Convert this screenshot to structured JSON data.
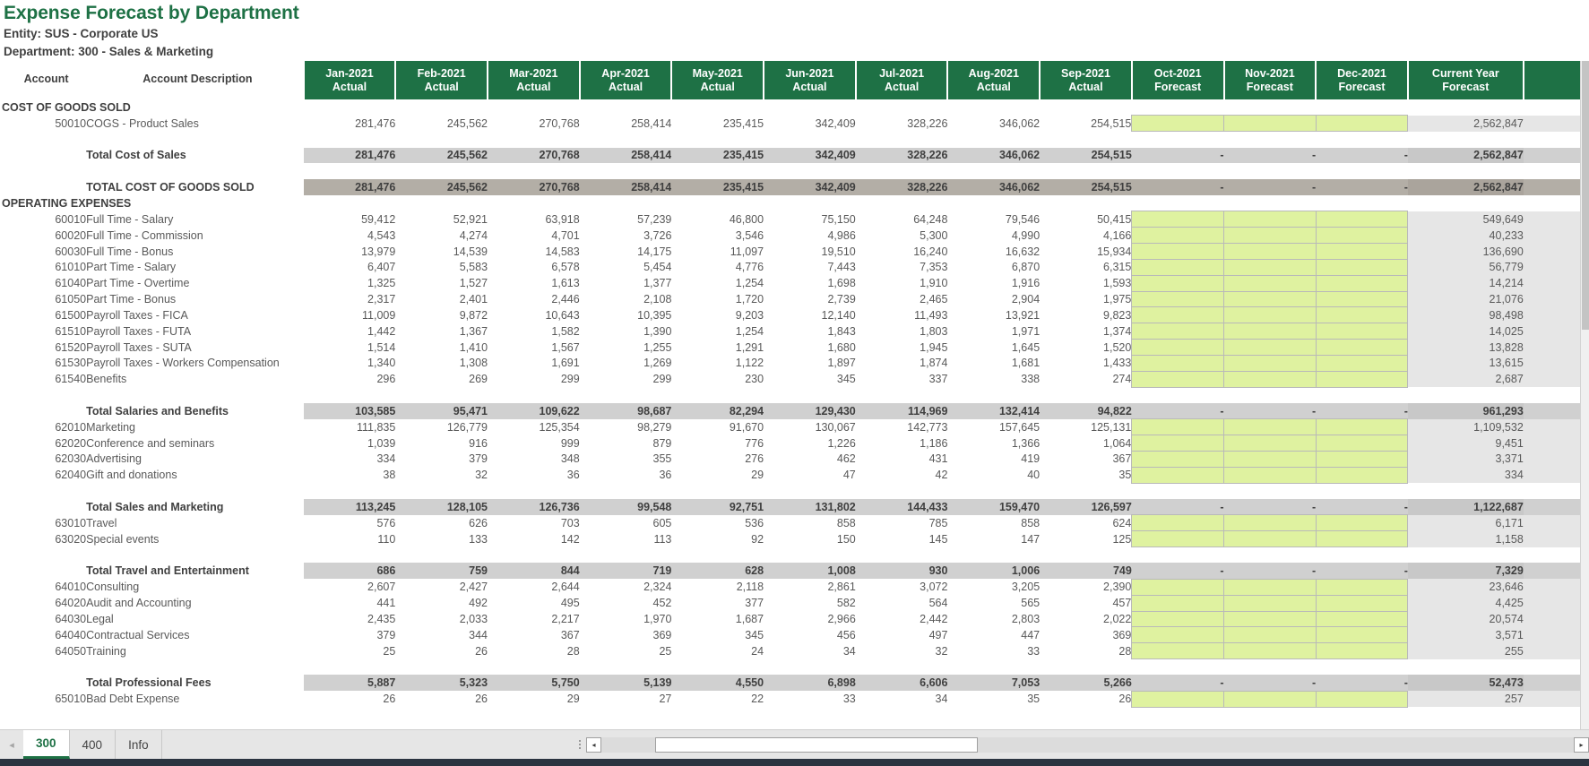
{
  "report": {
    "title": "Expense Forecast by Department",
    "entity_line": "Entity: SUS - Corporate US",
    "department_line": "Department:  300 - Sales & Marketing"
  },
  "columns": {
    "account_label": "Account",
    "description_label": "Account Description",
    "months": [
      {
        "period": "Jan-2021",
        "type": "Actual"
      },
      {
        "period": "Feb-2021",
        "type": "Actual"
      },
      {
        "period": "Mar-2021",
        "type": "Actual"
      },
      {
        "period": "Apr-2021",
        "type": "Actual"
      },
      {
        "period": "May-2021",
        "type": "Actual"
      },
      {
        "period": "Jun-2021",
        "type": "Actual"
      },
      {
        "period": "Jul-2021",
        "type": "Actual"
      },
      {
        "period": "Aug-2021",
        "type": "Actual"
      },
      {
        "period": "Sep-2021",
        "type": "Actual"
      },
      {
        "period": "Oct-2021",
        "type": "Forecast"
      },
      {
        "period": "Nov-2021",
        "type": "Forecast"
      },
      {
        "period": "Dec-2021",
        "type": "Forecast"
      }
    ],
    "current_year": {
      "period": "Current Year",
      "type": "Forecast"
    }
  },
  "accent_colors": {
    "header_green": "#1e7145",
    "title_green": "#1e7145",
    "input_cell_green": "#dff2a0",
    "subtotal_grey": "#d0d0d0",
    "grand_total_grey": "#b3aea6",
    "current_year_grey": "#e6e6e6"
  },
  "sections": [
    {
      "name": "COST OF GOODS SOLD",
      "rows": [
        {
          "kind": "detail",
          "account": "50010",
          "description": "COGS - Product Sales",
          "values": [
            "281,476",
            "245,562",
            "270,768",
            "258,414",
            "235,415",
            "342,409",
            "328,226",
            "346,062",
            "254,515",
            "",
            "",
            ""
          ],
          "current_year": "2,562,847"
        },
        {
          "kind": "spacer"
        },
        {
          "kind": "subtotal",
          "account": "",
          "description": "Total Cost of Sales",
          "values": [
            "281,476",
            "245,562",
            "270,768",
            "258,414",
            "235,415",
            "342,409",
            "328,226",
            "346,062",
            "254,515",
            "-",
            "-",
            "-"
          ],
          "current_year": "2,562,847"
        },
        {
          "kind": "spacer"
        },
        {
          "kind": "grandtotal",
          "account": "",
          "description": "TOTAL COST OF GOODS SOLD",
          "values": [
            "281,476",
            "245,562",
            "270,768",
            "258,414",
            "235,415",
            "342,409",
            "328,226",
            "346,062",
            "254,515",
            "-",
            "-",
            "-"
          ],
          "current_year": "2,562,847"
        }
      ]
    },
    {
      "name": "OPERATING EXPENSES",
      "rows": [
        {
          "kind": "detail",
          "account": "60010",
          "description": "Full Time - Salary",
          "values": [
            "59,412",
            "52,921",
            "63,918",
            "57,239",
            "46,800",
            "75,150",
            "64,248",
            "79,546",
            "50,415",
            "",
            "",
            ""
          ],
          "current_year": "549,649"
        },
        {
          "kind": "detail",
          "account": "60020",
          "description": "Full Time - Commission",
          "values": [
            "4,543",
            "4,274",
            "4,701",
            "3,726",
            "3,546",
            "4,986",
            "5,300",
            "4,990",
            "4,166",
            "",
            "",
            ""
          ],
          "current_year": "40,233"
        },
        {
          "kind": "detail",
          "account": "60030",
          "description": "Full Time - Bonus",
          "values": [
            "13,979",
            "14,539",
            "14,583",
            "14,175",
            "11,097",
            "19,510",
            "16,240",
            "16,632",
            "15,934",
            "",
            "",
            ""
          ],
          "current_year": "136,690"
        },
        {
          "kind": "detail",
          "account": "61010",
          "description": "Part Time - Salary",
          "values": [
            "6,407",
            "5,583",
            "6,578",
            "5,454",
            "4,776",
            "7,443",
            "7,353",
            "6,870",
            "6,315",
            "",
            "",
            ""
          ],
          "current_year": "56,779"
        },
        {
          "kind": "detail",
          "account": "61040",
          "description": "Part Time - Overtime",
          "values": [
            "1,325",
            "1,527",
            "1,613",
            "1,377",
            "1,254",
            "1,698",
            "1,910",
            "1,916",
            "1,593",
            "",
            "",
            ""
          ],
          "current_year": "14,214"
        },
        {
          "kind": "detail",
          "account": "61050",
          "description": "Part Time - Bonus",
          "values": [
            "2,317",
            "2,401",
            "2,446",
            "2,108",
            "1,720",
            "2,739",
            "2,465",
            "2,904",
            "1,975",
            "",
            "",
            ""
          ],
          "current_year": "21,076"
        },
        {
          "kind": "detail",
          "account": "61500",
          "description": "Payroll Taxes - FICA",
          "values": [
            "11,009",
            "9,872",
            "10,643",
            "10,395",
            "9,203",
            "12,140",
            "11,493",
            "13,921",
            "9,823",
            "",
            "",
            ""
          ],
          "current_year": "98,498"
        },
        {
          "kind": "detail",
          "account": "61510",
          "description": "Payroll Taxes - FUTA",
          "values": [
            "1,442",
            "1,367",
            "1,582",
            "1,390",
            "1,254",
            "1,843",
            "1,803",
            "1,971",
            "1,374",
            "",
            "",
            ""
          ],
          "current_year": "14,025"
        },
        {
          "kind": "detail",
          "account": "61520",
          "description": "Payroll Taxes - SUTA",
          "values": [
            "1,514",
            "1,410",
            "1,567",
            "1,255",
            "1,291",
            "1,680",
            "1,945",
            "1,645",
            "1,520",
            "",
            "",
            ""
          ],
          "current_year": "13,828"
        },
        {
          "kind": "detail",
          "account": "61530",
          "description": "Payroll Taxes - Workers Compensation",
          "values": [
            "1,340",
            "1,308",
            "1,691",
            "1,269",
            "1,122",
            "1,897",
            "1,874",
            "1,681",
            "1,433",
            "",
            "",
            ""
          ],
          "current_year": "13,615"
        },
        {
          "kind": "detail",
          "account": "61540",
          "description": "Benefits",
          "values": [
            "296",
            "269",
            "299",
            "299",
            "230",
            "345",
            "337",
            "338",
            "274",
            "",
            "",
            ""
          ],
          "current_year": "2,687"
        },
        {
          "kind": "spacer"
        },
        {
          "kind": "subtotal",
          "account": "",
          "description": "Total Salaries and Benefits",
          "values": [
            "103,585",
            "95,471",
            "109,622",
            "98,687",
            "82,294",
            "129,430",
            "114,969",
            "132,414",
            "94,822",
            "-",
            "-",
            "-"
          ],
          "current_year": "961,293"
        },
        {
          "kind": "detail",
          "account": "62010",
          "description": "Marketing",
          "values": [
            "111,835",
            "126,779",
            "125,354",
            "98,279",
            "91,670",
            "130,067",
            "142,773",
            "157,645",
            "125,131",
            "",
            "",
            ""
          ],
          "current_year": "1,109,532"
        },
        {
          "kind": "detail",
          "account": "62020",
          "description": "Conference and seminars",
          "values": [
            "1,039",
            "916",
            "999",
            "879",
            "776",
            "1,226",
            "1,186",
            "1,366",
            "1,064",
            "",
            "",
            ""
          ],
          "current_year": "9,451"
        },
        {
          "kind": "detail",
          "account": "62030",
          "description": "Advertising",
          "values": [
            "334",
            "379",
            "348",
            "355",
            "276",
            "462",
            "431",
            "419",
            "367",
            "",
            "",
            ""
          ],
          "current_year": "3,371"
        },
        {
          "kind": "detail",
          "account": "62040",
          "description": "Gift and donations",
          "values": [
            "38",
            "32",
            "36",
            "36",
            "29",
            "47",
            "42",
            "40",
            "35",
            "",
            "",
            ""
          ],
          "current_year": "334"
        },
        {
          "kind": "spacer"
        },
        {
          "kind": "subtotal",
          "account": "",
          "description": "Total Sales and Marketing",
          "values": [
            "113,245",
            "128,105",
            "126,736",
            "99,548",
            "92,751",
            "131,802",
            "144,433",
            "159,470",
            "126,597",
            "-",
            "-",
            "-"
          ],
          "current_year": "1,122,687"
        },
        {
          "kind": "detail",
          "account": "63010",
          "description": "Travel",
          "values": [
            "576",
            "626",
            "703",
            "605",
            "536",
            "858",
            "785",
            "858",
            "624",
            "",
            "",
            ""
          ],
          "current_year": "6,171"
        },
        {
          "kind": "detail",
          "account": "63020",
          "description": "Special events",
          "values": [
            "110",
            "133",
            "142",
            "113",
            "92",
            "150",
            "145",
            "147",
            "125",
            "",
            "",
            ""
          ],
          "current_year": "1,158"
        },
        {
          "kind": "spacer"
        },
        {
          "kind": "subtotal",
          "account": "",
          "description": "Total Travel and Entertainment",
          "values": [
            "686",
            "759",
            "844",
            "719",
            "628",
            "1,008",
            "930",
            "1,006",
            "749",
            "-",
            "-",
            "-"
          ],
          "current_year": "7,329"
        },
        {
          "kind": "detail",
          "account": "64010",
          "description": "Consulting",
          "values": [
            "2,607",
            "2,427",
            "2,644",
            "2,324",
            "2,118",
            "2,861",
            "3,072",
            "3,205",
            "2,390",
            "",
            "",
            ""
          ],
          "current_year": "23,646"
        },
        {
          "kind": "detail",
          "account": "64020",
          "description": "Audit and Accounting",
          "values": [
            "441",
            "492",
            "495",
            "452",
            "377",
            "582",
            "564",
            "565",
            "457",
            "",
            "",
            ""
          ],
          "current_year": "4,425"
        },
        {
          "kind": "detail",
          "account": "64030",
          "description": "Legal",
          "values": [
            "2,435",
            "2,033",
            "2,217",
            "1,970",
            "1,687",
            "2,966",
            "2,442",
            "2,803",
            "2,022",
            "",
            "",
            ""
          ],
          "current_year": "20,574"
        },
        {
          "kind": "detail",
          "account": "64040",
          "description": "Contractual Services",
          "values": [
            "379",
            "344",
            "367",
            "369",
            "345",
            "456",
            "497",
            "447",
            "369",
            "",
            "",
            ""
          ],
          "current_year": "3,571"
        },
        {
          "kind": "detail",
          "account": "64050",
          "description": "Training",
          "values": [
            "25",
            "26",
            "28",
            "25",
            "24",
            "34",
            "32",
            "33",
            "28",
            "",
            "",
            ""
          ],
          "current_year": "255"
        },
        {
          "kind": "spacer"
        },
        {
          "kind": "subtotal",
          "account": "",
          "description": "Total Professional Fees",
          "values": [
            "5,887",
            "5,323",
            "5,750",
            "5,139",
            "4,550",
            "6,898",
            "6,606",
            "7,053",
            "5,266",
            "-",
            "-",
            "-"
          ],
          "current_year": "52,473"
        },
        {
          "kind": "detail",
          "account": "65010",
          "description": "Bad Debt Expense",
          "values": [
            "26",
            "26",
            "29",
            "27",
            "22",
            "33",
            "34",
            "35",
            "26",
            "",
            "",
            ""
          ],
          "current_year": "257"
        }
      ]
    }
  ],
  "sheet_tabs": [
    {
      "label": "300",
      "active": true
    },
    {
      "label": "400",
      "active": false
    },
    {
      "label": "Info",
      "active": false
    }
  ],
  "scroll": {
    "prev_arrow": "◂",
    "next_arrow": "▸",
    "hscroll_left": "◂",
    "hscroll_right": "▸"
  }
}
